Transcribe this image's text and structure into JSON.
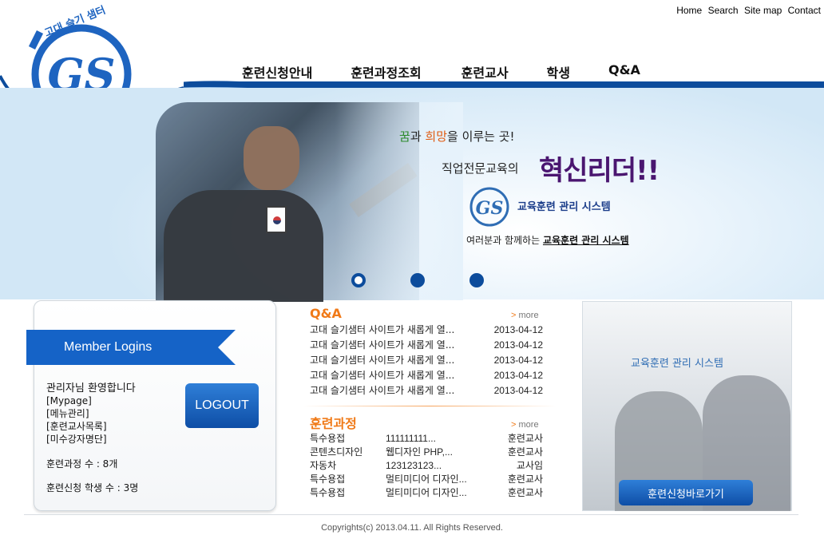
{
  "header": {
    "logo_text": "고대 슬기 샘터",
    "logo_mark": "GS",
    "top_links": [
      "Home",
      "Search",
      "Site map",
      "Contact"
    ],
    "nav": [
      "훈련신청안내",
      "훈련과정조회",
      "훈련교사",
      "학생",
      "Q&A"
    ]
  },
  "hero": {
    "line1_a": "꿈",
    "line1_b": "과 ",
    "line1_c": "희망",
    "line1_d": "을 이루는 곳!",
    "line2": "직업전문교육의",
    "headline": "혁신리더!!",
    "system_name": "교육훈련 관리 시스템",
    "tagline_prefix": "여러분과 함께하는 ",
    "tagline_bold": "교육훈련 관리 시스템",
    "slides": 3,
    "active_slide": 1
  },
  "login": {
    "title": "Member Logins",
    "welcome": "관리자님 환영합니다",
    "links": [
      "[Mypage]",
      "[메뉴관리]",
      "[훈련교사목록]",
      "[미수강자명단]"
    ],
    "logout_label": "LOGOUT",
    "course_count": "훈련과정 수 : 8개",
    "student_count": "훈련신청 학생 수 : 3명"
  },
  "qa": {
    "title": "Q&A",
    "more_arrow": ">",
    "more_label": " more",
    "items": [
      {
        "title": "고대 슬기샘터 사이트가 새롭게 열...",
        "date": "2013-04-12"
      },
      {
        "title": "고대 슬기샘터 사이트가 새롭게 열...",
        "date": "2013-04-12"
      },
      {
        "title": "고대 슬기샘터 사이트가 새롭게 열...",
        "date": "2013-04-12"
      },
      {
        "title": "고대 슬기샘터 사이트가 새롭게 열...",
        "date": "2013-04-12"
      },
      {
        "title": "고대 슬기샘터 사이트가 새롭게 열...",
        "date": "2013-04-12"
      }
    ]
  },
  "courses": {
    "title": "훈련과정",
    "more_arrow": ">",
    "more_label": " more",
    "items": [
      {
        "category": "특수용접",
        "name": "111111111...",
        "teacher": "훈련교사"
      },
      {
        "category": "콘텐츠디자인",
        "name": "웹디자인 PHP,...",
        "teacher": "훈련교사"
      },
      {
        "category": "자동차",
        "name": "123123123...",
        "teacher": "교사임"
      },
      {
        "category": "특수용접",
        "name": "멀티미디어 디자인...",
        "teacher": "훈련교사"
      },
      {
        "category": "특수용접",
        "name": "멀티미디어 디자인...",
        "teacher": "훈련교사"
      }
    ]
  },
  "promo": {
    "title": "교육훈련 관리 시스템",
    "button": "훈련신청바로가기"
  },
  "footer": {
    "copyright": "Copyrights(c) 2013.04.11. All Rights Reserved."
  },
  "colors": {
    "brand_blue": "#0c4c9c",
    "accent_orange": "#f07a18",
    "headline_purple": "#4a1670"
  }
}
